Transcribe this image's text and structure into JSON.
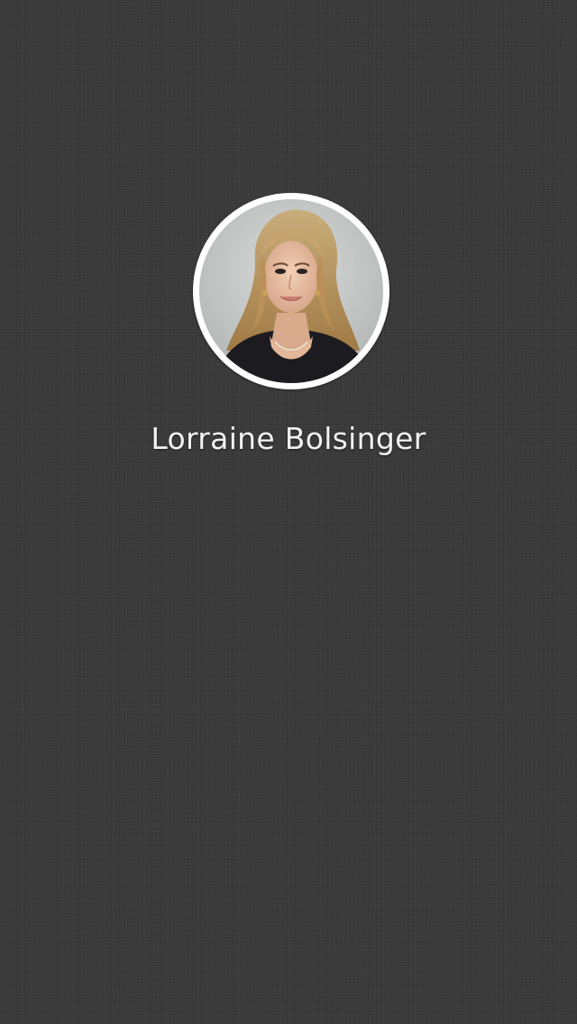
{
  "profile": {
    "name": "Lorraine Bolsinger",
    "avatar_icon": "profile-photo"
  },
  "colors": {
    "background": "#3a3a3b",
    "avatar_ring": "#ffffff",
    "name_text": "#f2f2f2"
  }
}
